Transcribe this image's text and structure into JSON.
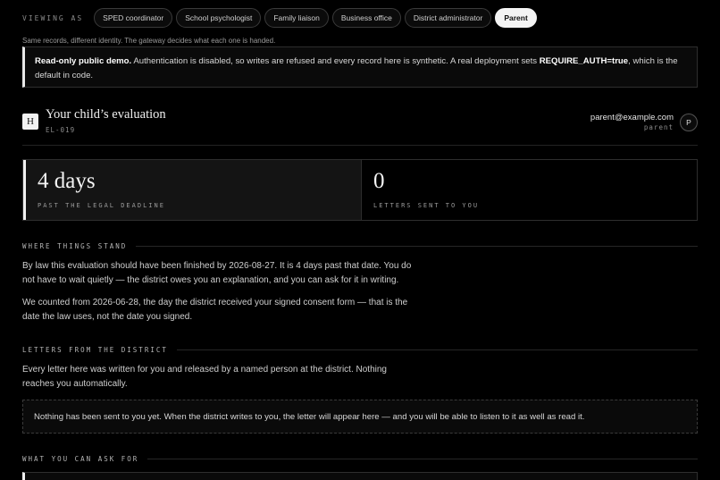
{
  "role_switcher": {
    "viewing_as_label": "VIEWING AS",
    "roles": [
      {
        "label": "SPED coordinator",
        "active": false
      },
      {
        "label": "School psychologist",
        "active": false
      },
      {
        "label": "Family liaison",
        "active": false
      },
      {
        "label": "Business office",
        "active": false
      },
      {
        "label": "District administrator",
        "active": false
      },
      {
        "label": "Parent",
        "active": true
      }
    ],
    "note": "Same records, different identity. The gateway decides what each one is handed."
  },
  "banner": {
    "strong": "Read-only public demo.",
    "text_1": " Authentication is disabled, so writes are refused and every record here is synthetic. A real deployment sets ",
    "code": "REQUIRE_AUTH=true",
    "text_2": ", which is the default in code."
  },
  "case": {
    "icon_letter": "H",
    "title": "Your child’s evaluation",
    "id": "EL-019"
  },
  "user": {
    "email": "parent@example.com",
    "role": "parent",
    "avatar_letter": "P"
  },
  "stats": [
    {
      "value": "4 days",
      "label": "PAST THE LEGAL DEADLINE"
    },
    {
      "value": "0",
      "label": "LETTERS SENT TO YOU"
    }
  ],
  "sections": {
    "where": {
      "heading": "WHERE THINGS STAND",
      "p1": "By law this evaluation should have been finished by 2026-08-27. It is 4 days past that date. You do not have to wait quietly — the district owes you an explanation, and you can ask for it in writing.",
      "p2": "We counted from 2026-06-28, the day the district received your signed consent form — that is the date the law uses, not the date you signed."
    },
    "letters": {
      "heading": "LETTERS FROM THE DISTRICT",
      "p1": "Every letter here was written for you and released by a named person at the district. Nothing reaches you automatically.",
      "empty": "Nothing has been sent to you yet. When the district writes to you, the letter will appear here — and you will be able to listen to it as well as read it."
    },
    "ask": {
      "heading": "WHAT YOU CAN ASK FOR"
    }
  }
}
